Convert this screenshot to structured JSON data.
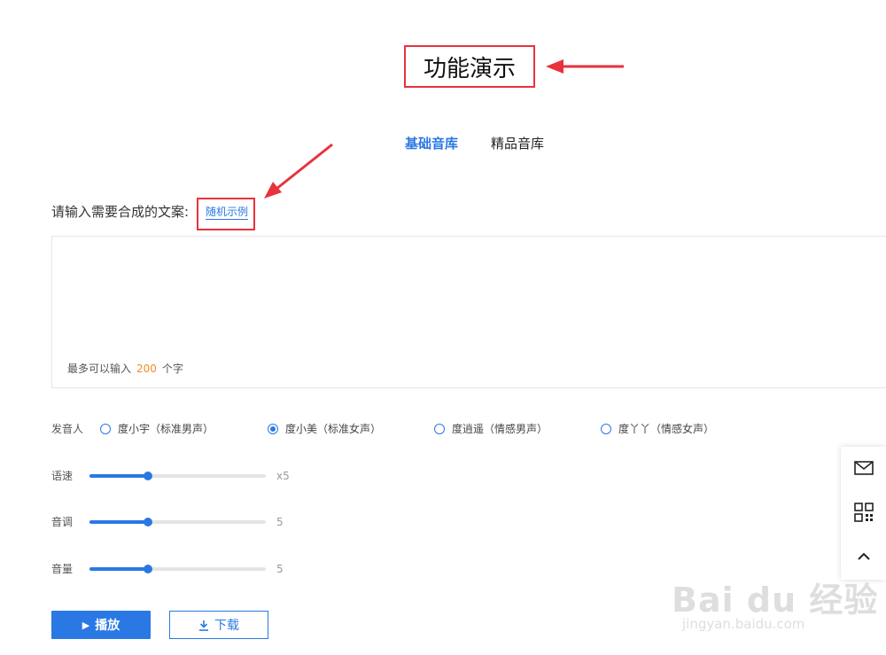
{
  "title": "功能演示",
  "tabs": [
    {
      "label": "基础音库",
      "active": true
    },
    {
      "label": "精品音库",
      "active": false
    }
  ],
  "input": {
    "label": "请输入需要合成的文案:",
    "random_link": "随机示例",
    "char_limit_prefix": "最多可以输入",
    "char_limit_value": "200",
    "char_limit_suffix": "个字"
  },
  "speaker": {
    "label": "发音人",
    "options": [
      {
        "label": "度小宇（标准男声）",
        "selected": false
      },
      {
        "label": "度小美（标准女声）",
        "selected": true
      },
      {
        "label": "度逍遥（情感男声）",
        "selected": false
      },
      {
        "label": "度丫丫（情感女声）",
        "selected": false
      }
    ]
  },
  "sliders": [
    {
      "label": "语速",
      "value_text": "x5",
      "fraction": 0.33
    },
    {
      "label": "音调",
      "value_text": "5",
      "fraction": 0.33
    },
    {
      "label": "音量",
      "value_text": "5",
      "fraction": 0.33
    }
  ],
  "buttons": {
    "play": "播放",
    "download": "下载"
  },
  "side_toolbar": [
    "mail-icon",
    "qrcode-icon",
    "back-to-top-icon"
  ],
  "watermark": {
    "logo": "Bai du 经验",
    "url": "jingyan.baidu.com"
  },
  "colors": {
    "accent": "#2a78e4",
    "annotation_red": "#e8323c",
    "limit_orange": "#f08a2c"
  }
}
